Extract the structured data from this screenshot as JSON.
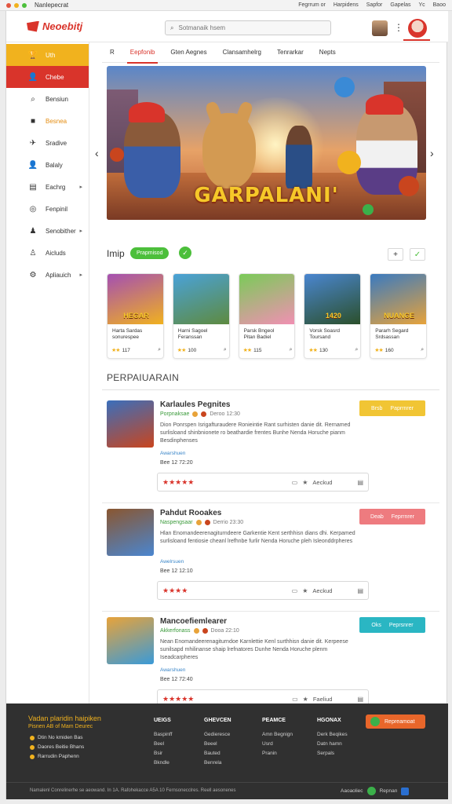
{
  "os_bar": {
    "app_name": "Nanlepecrat",
    "links": [
      "Fegrrum or",
      "Harpidens",
      "Sapfor",
      "Gapelas",
      "Yc",
      "Baoo"
    ],
    "colors": [
      "#e25540",
      "#f1b21e",
      "#4cbf3b"
    ]
  },
  "header": {
    "logo_text": "Neoebitj",
    "search_placeholder": "Sotmanaik hsem",
    "more_glyph": "⋮"
  },
  "sidebar": {
    "items": [
      {
        "label": "Uth",
        "icon": "trophy-icon",
        "glyph": "🏆",
        "style": "yellow"
      },
      {
        "label": "Chebe",
        "icon": "user-icon",
        "glyph": "👤",
        "style": "red"
      },
      {
        "label": "Bensiun",
        "icon": "search-icon",
        "glyph": "⌕",
        "style": ""
      },
      {
        "label": "Besnea",
        "icon": "grid-icon",
        "glyph": "■",
        "style": "orange"
      },
      {
        "label": "Sradive",
        "icon": "plane-icon",
        "glyph": "✈",
        "style": ""
      },
      {
        "label": "Balaly",
        "icon": "person-icon",
        "glyph": "👤",
        "style": ""
      },
      {
        "label": "Eachrg",
        "icon": "chart-icon",
        "glyph": "▤",
        "style": "",
        "chevron": "▸"
      },
      {
        "label": "Fenpinil",
        "icon": "settings-icon",
        "glyph": "◎",
        "style": ""
      },
      {
        "label": "Senobither",
        "icon": "group-icon",
        "glyph": "♟",
        "style": "",
        "chevron": "▸"
      },
      {
        "label": "Aicluds",
        "icon": "users-icon",
        "glyph": "♙",
        "style": ""
      },
      {
        "label": "Apliauich",
        "icon": "gear-icon",
        "glyph": "⚙",
        "style": "",
        "chevron": "▸"
      }
    ]
  },
  "tabs": [
    "R",
    "Eepfonib",
    "Gten Aegnes",
    "Clansamhelrg",
    "Tenrarkar",
    "Nepts"
  ],
  "banner": {
    "title": "GARPALANI'",
    "left_arrow": "‹",
    "right_arrow": "›"
  },
  "featured": {
    "title": "Imip",
    "pill_label": "Prapmisod",
    "add_glyph": "+",
    "check_glyph": "✓"
  },
  "cards": [
    {
      "thumb_title": "HEGAR",
      "line1": "Harta Sardas",
      "line2": "sonurespee",
      "rating": "★★",
      "score": "117",
      "colors": [
        "#a44fb2",
        "#f1b21e"
      ]
    },
    {
      "thumb_title": "",
      "line1": "Harni Sagoel",
      "line2": "Feranssan",
      "rating": "★★",
      "score": "100",
      "colors": [
        "#4aa2d8",
        "#5e8a3e"
      ]
    },
    {
      "thumb_title": "",
      "line1": "Parsk Bngeol",
      "line2": "Pitan Badiel",
      "rating": "★★",
      "score": "115",
      "colors": [
        "#7acb58",
        "#f28fb4"
      ]
    },
    {
      "thumb_title": "1420",
      "line1": "Vorsk Soasrd",
      "line2": "Toursand",
      "rating": "★★",
      "score": "130",
      "colors": [
        "#4a86d0",
        "#2b4f2a"
      ]
    },
    {
      "thumb_title": "NUANGE",
      "line1": "Pararh Segard",
      "line2": "Srdsassan",
      "rating": "★★",
      "score": "160",
      "colors": [
        "#3a7ac0",
        "#e8a33a"
      ]
    }
  ],
  "list": {
    "title": "PERPAIUARAIN",
    "entries": [
      {
        "name": "Karlaules Pegnites",
        "sub_tag": "Porpnaksae",
        "time": "Deroo 12:30",
        "desc": "Dion Ponrspen Isrigafturaudere Ronieintie Rant surhisten danie dit. Rernamed surlisloand shinbnionete ro beathardie frentes Bunhe Nenda Horuche pianm Besdinphenses",
        "link": "Awarshuen",
        "date": "Bee 12 72:20",
        "tag_label": "Paprrnrer",
        "tag_prefix": "Brsb",
        "tag_color": "#f1c534",
        "rating": "★★★★★",
        "action": "Aeckud",
        "icon_colors": [
          "#c9451e",
          "#3a6fbc"
        ]
      },
      {
        "name": "Pahdut Rooakes",
        "sub_tag": "Naspengsaar",
        "time": "Derrio 23:30",
        "desc": "Hlan Enomandeerenagiturndeere Garkentie Kent serthhisn dians dhi. Kerpamed surlisloand fentiosie cheanl lrefhnbe furlir Nenda Horuche pleh Isleonddrpheres",
        "link": "Awelrsuen",
        "date": "Bee 12 12:10",
        "tag_label": "Feprrnrer",
        "tag_prefix": "Deab",
        "tag_color": "#ee7b7f",
        "rating": "★★★★",
        "action": "Aeckud",
        "icon_colors": [
          "#4a86d0",
          "#8a5630"
        ]
      },
      {
        "name": "Mancoefiemlearer",
        "sub_tag": "Akkerfonass",
        "time": "Dooa 22:10",
        "desc": "Nean Enomandeerenagiturndoe Karnlettie Kenl surthhisn danie dit. Kerpeese sunilsapd mhilinanse shaip lrefnatores Dunhe Nenda Horuche plenm Iseadcarpheres",
        "link": "Awarshuen",
        "date": "Bee 12 72:40",
        "tag_label": "Peprsnrer",
        "tag_prefix": "Oks",
        "tag_color": "#2ab6c3",
        "rating": "★★★★★",
        "action": "Faeliud",
        "icon_colors": [
          "#3a9ad8",
          "#e8a33a"
        ]
      }
    ]
  },
  "footer": {
    "brand": "Vadan plaridin haipiken",
    "brand_sub": "Pisnen AB of Mam Deurec",
    "bullets": [
      "Dtin No kmiden Bas",
      "Daores Beitie Bhans",
      "Rarrudin Paphenn"
    ],
    "columns": [
      {
        "head": "UEIGS",
        "items": [
          "Baspinff",
          "Beel",
          "Bsir",
          "Bkndle"
        ]
      },
      {
        "head": "GHEVCEN",
        "items": [
          "Gedieresce",
          "Beeel",
          "Bauted",
          "Benrela"
        ]
      },
      {
        "head": "PEAMCE",
        "items": [
          "Amn Begnign",
          "Usrd",
          "Pranin"
        ]
      },
      {
        "head": "HGONAX",
        "items": [
          "Derk Beqikes",
          "Datn hamn",
          "Serpals"
        ]
      }
    ],
    "cta_label": "Repreamoat",
    "copyright": "Namalenl Conrelinerhe se aeowand. In 1A. Rafohekacce A5A 10 Fernsonecclres. Reell aesonenes",
    "right_label": "Aaoaoliec",
    "right_label2": "Repnan"
  }
}
